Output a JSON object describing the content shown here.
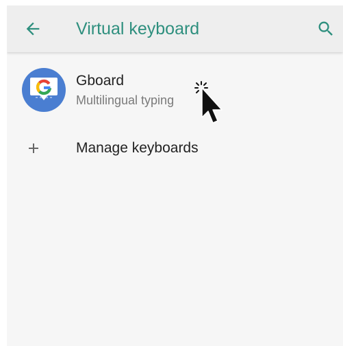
{
  "app_bar": {
    "title": "Virtual keyboard",
    "back_icon": "arrow-back-icon",
    "search_icon": "search-icon",
    "accent_color": "#2e8f7e"
  },
  "keyboards": [
    {
      "label": "Gboard",
      "subtitle": "Multilingual typing",
      "icon": "gboard-icon",
      "icon_color": "#4a7ed1"
    }
  ],
  "manage": {
    "label": "Manage keyboards",
    "icon": "plus-icon"
  },
  "cursor": {
    "icon": "mouse-pointer-click-icon"
  }
}
